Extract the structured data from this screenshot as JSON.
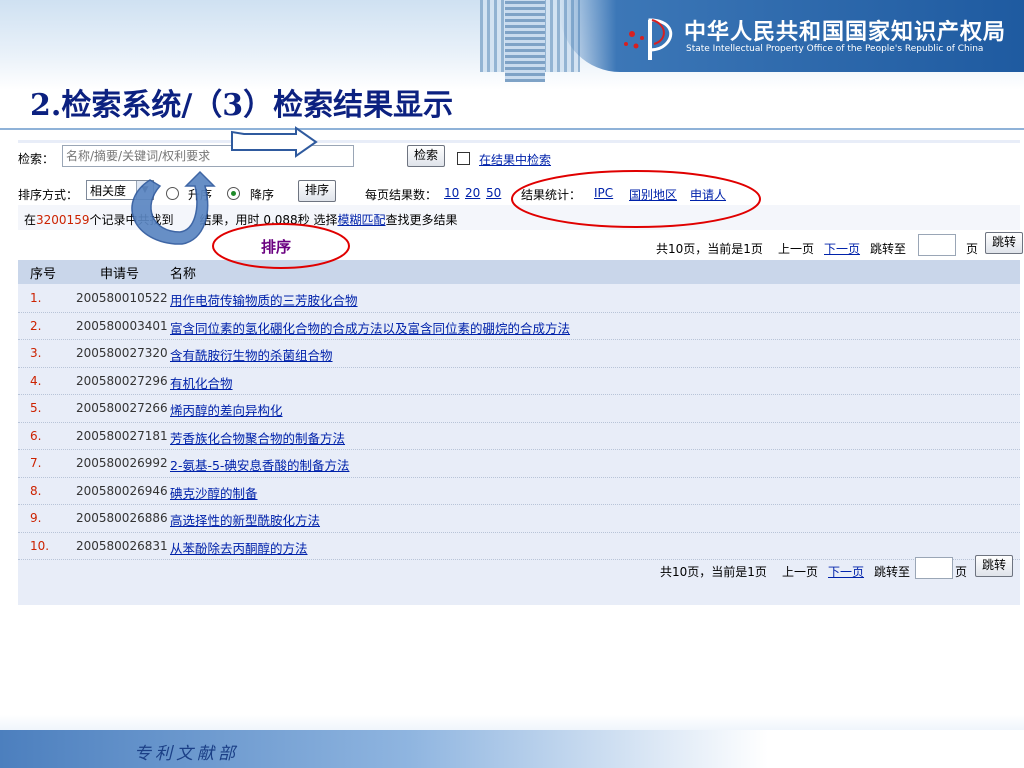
{
  "banner": {
    "org_cn": "中华人民共和国国家知识产权局",
    "org_en": "State Intellectual Property Office of the People's Republic of China"
  },
  "slide": {
    "title": "2.检索系统/（3）检索结果显示",
    "footer": "专利文献部"
  },
  "search": {
    "label": "检索：",
    "placeholder": "名称/摘要/关键词/权利要求",
    "button": "检索",
    "in_results": "在结果中检索"
  },
  "sort": {
    "label": "排序方式：",
    "selected": "相关度",
    "asc": "升序",
    "desc": "降序",
    "button": "排序",
    "annotation": "排序",
    "desc_selected": true
  },
  "per_page": {
    "label": "每页结果数：",
    "options": [
      "10",
      "20",
      "50"
    ]
  },
  "stats": {
    "label": "结果统计：",
    "links": [
      "IPC",
      "国别地区",
      "申请人"
    ]
  },
  "info": {
    "prefix": "在",
    "total": "3200159",
    "middle": "个记录中共找到",
    "found": "",
    "suffix": "结果，用时",
    "time": "0.088",
    "unit": "秒 选择",
    "fuzzy": "模糊匹配",
    "tail": "查找更多结果"
  },
  "pager": {
    "summary": "共10页，当前是1页",
    "prev": "上一页",
    "next": "下一页",
    "jump_to": "跳转至",
    "page_unit": "页",
    "jump_button": "跳转"
  },
  "table": {
    "columns": [
      "序号",
      "申请号",
      "名称"
    ],
    "rows": [
      {
        "no": "1.",
        "app": "200580010522",
        "name": "用作电荷传输物质的三芳胺化合物"
      },
      {
        "no": "2.",
        "app": "200580003401",
        "name": "富含同位素的氢化硼化合物的合成方法以及富含同位素的硼烷的合成方法"
      },
      {
        "no": "3.",
        "app": "200580027320",
        "name": "含有酰胺衍生物的杀菌组合物"
      },
      {
        "no": "4.",
        "app": "200580027296",
        "name": "有机化合物"
      },
      {
        "no": "5.",
        "app": "200580027266",
        "name": "烯丙醇的差向异构化"
      },
      {
        "no": "6.",
        "app": "200580027181",
        "name": "芳香族化合物聚合物的制备方法"
      },
      {
        "no": "7.",
        "app": "200580026992",
        "name": "2-氨基-5-碘安息香酸的制备方法"
      },
      {
        "no": "8.",
        "app": "200580026946",
        "name": "碘克沙醇的制备"
      },
      {
        "no": "9.",
        "app": "200580026886",
        "name": "高选择性的新型酰胺化方法"
      },
      {
        "no": "10.",
        "app": "200580026831",
        "name": "从苯酚除去丙酮醇的方法"
      }
    ]
  },
  "colors": {
    "title": "#0c2180",
    "link": "#0022aa",
    "index": "#cc2200",
    "annotation_red": "#e00000",
    "annotation_blue": "#2f5a9e"
  }
}
